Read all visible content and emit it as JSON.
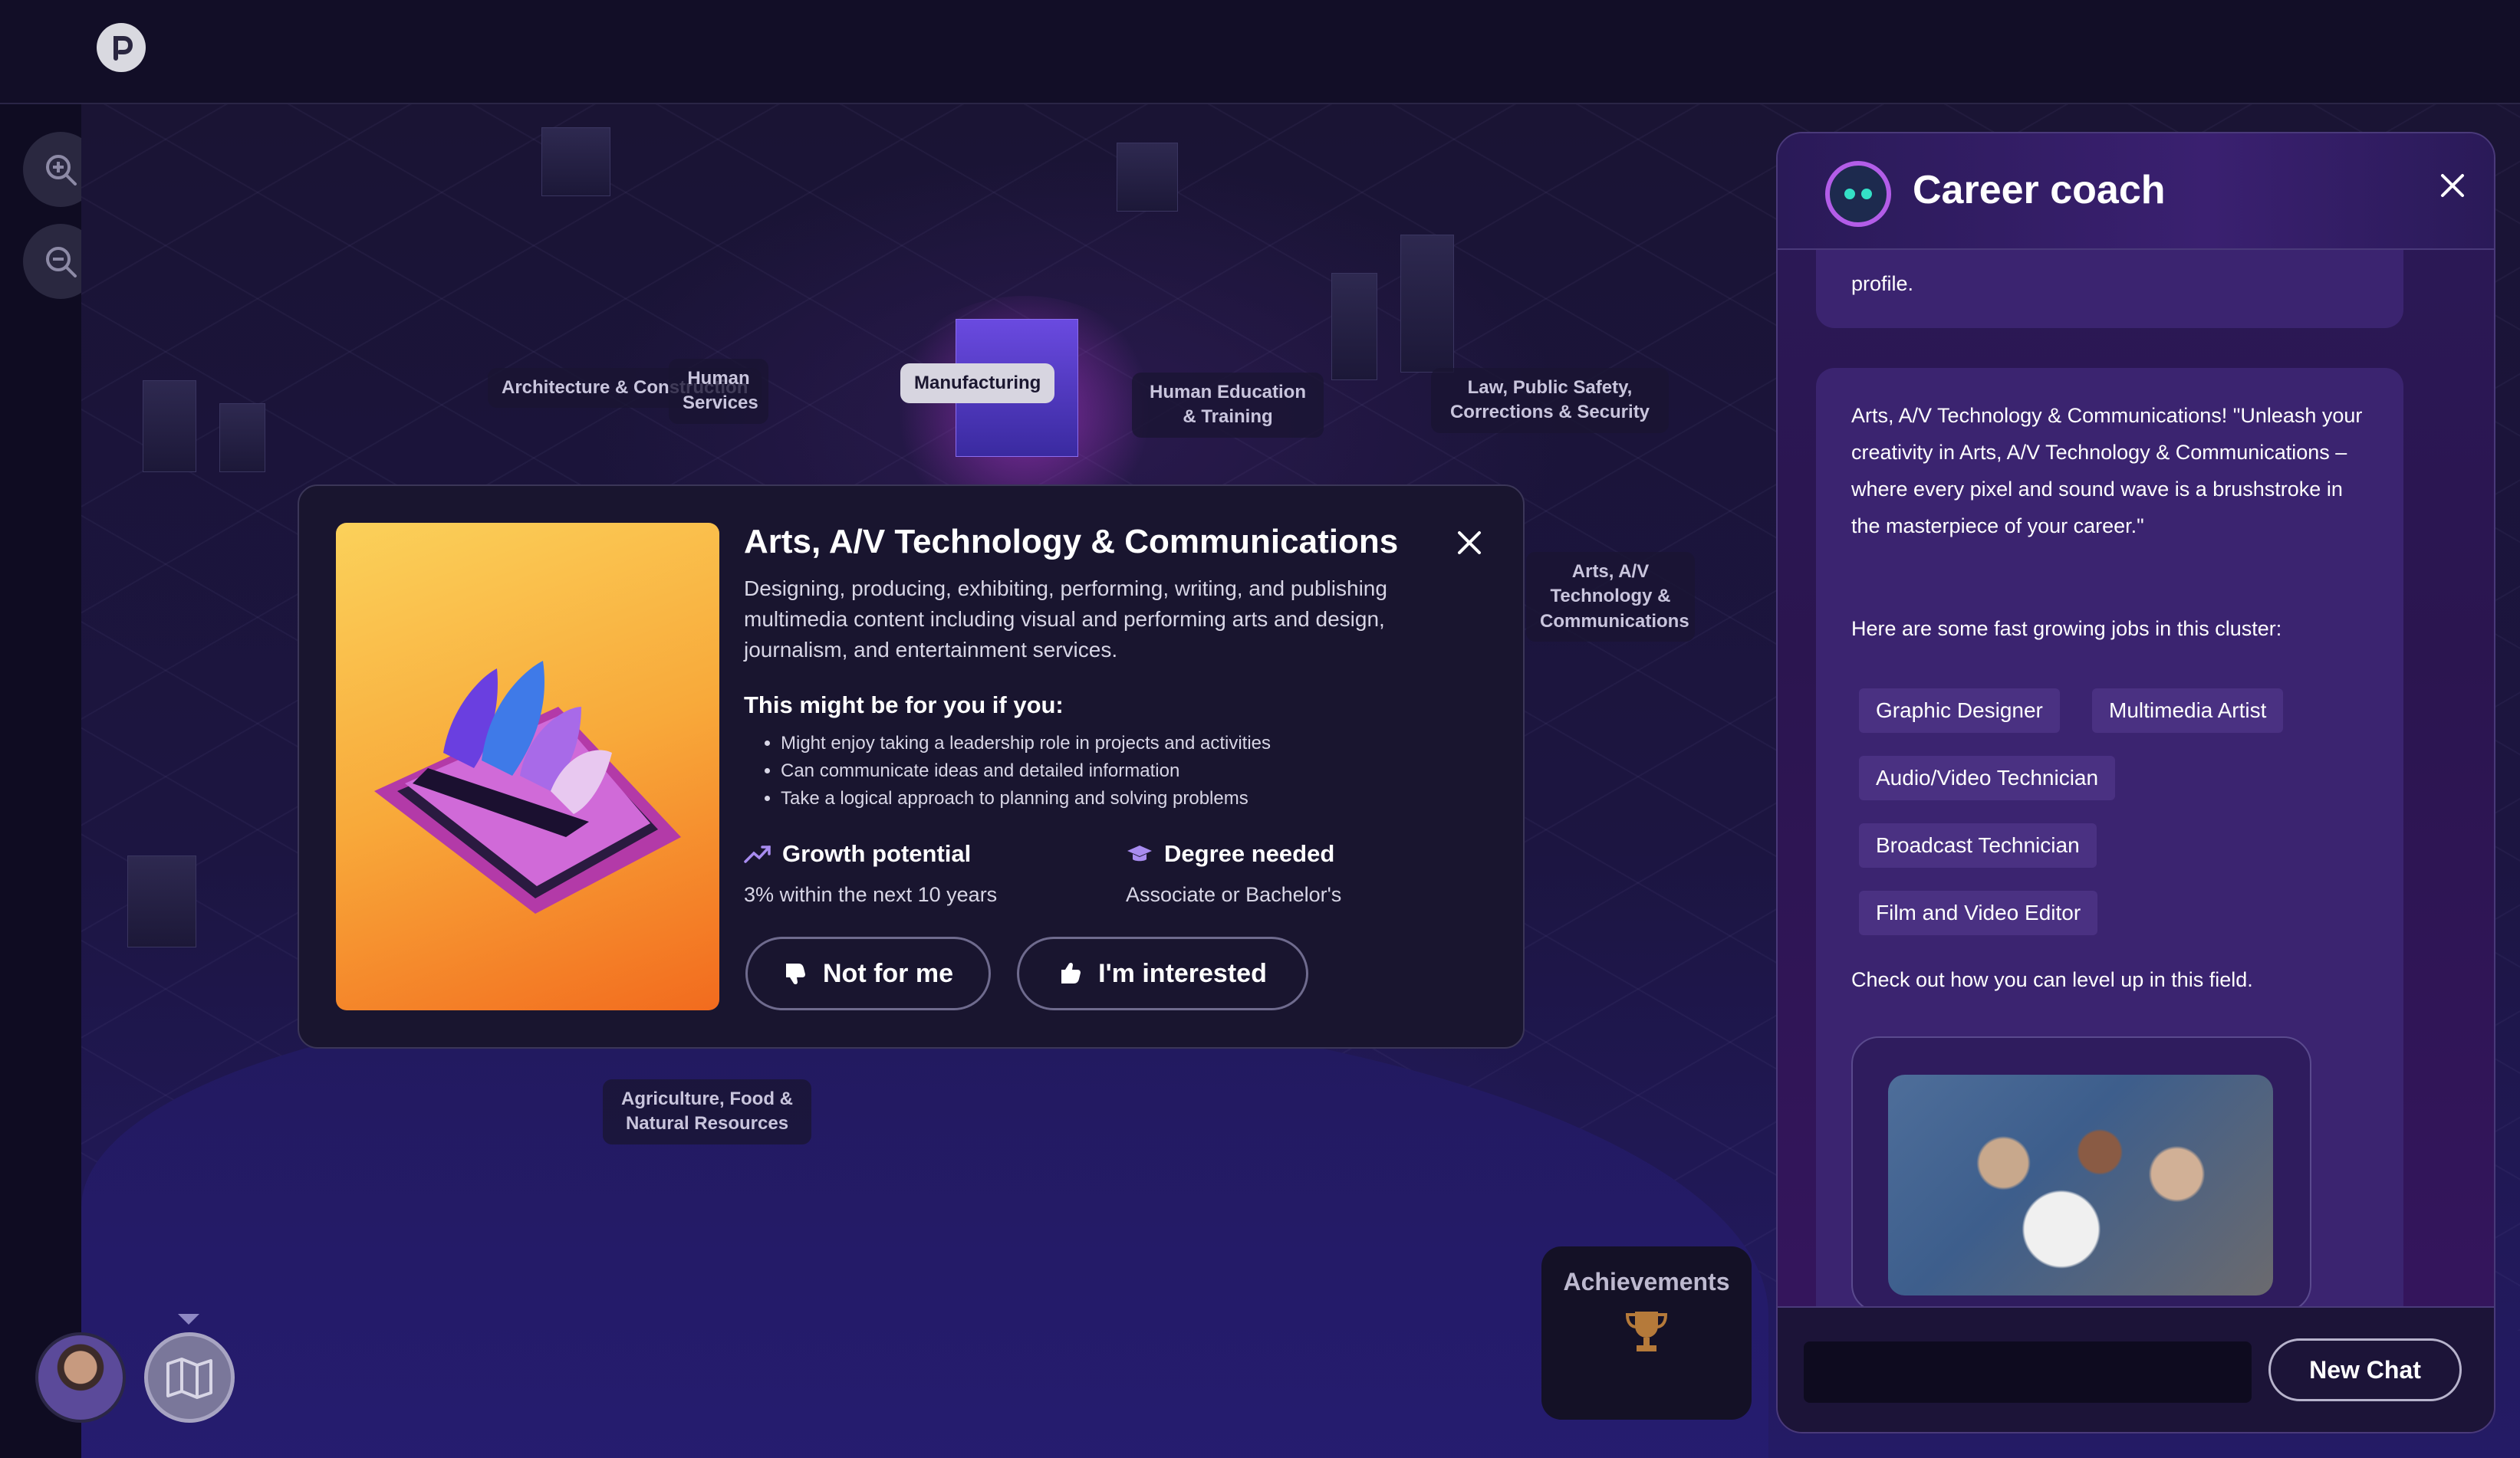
{
  "app": {
    "logo_icon": "pearson-p-icon"
  },
  "map": {
    "zoom_in_icon": "zoom-in-icon",
    "zoom_out_icon": "zoom-out-icon",
    "clusters": [
      {
        "label": "Architecture & Construction"
      },
      {
        "label": "Human Services"
      },
      {
        "label": "Manufacturing"
      },
      {
        "label": "Human Education & Training"
      },
      {
        "label": "Law, Public Safety, Corrections & Security"
      },
      {
        "label": "Arts, A/V Technology & Communications"
      },
      {
        "label": "Agriculture, Food & Natural Resources"
      }
    ]
  },
  "modal": {
    "title": "Arts, A/V Technology & Communications",
    "description": "Designing, producing, exhibiting, performing, writing, and publishing multimedia content including visual and performing arts and design, journalism, and entertainment services.",
    "subheading": "This might be for you if you:",
    "bullets": [
      "Might enjoy taking a leadership role in projects and activities",
      "Can communicate ideas and detailed information",
      "Take a logical approach to planning and solving problems"
    ],
    "growth_label": "Growth potential",
    "growth_value": "3% within the next 10 years",
    "degree_label": "Degree needed",
    "degree_value": "Associate or Bachelor's",
    "not_for_me_label": "Not for me",
    "interested_label": "I'm interested"
  },
  "achievements": {
    "title": "Achievements"
  },
  "coach": {
    "title": "Career coach",
    "prev_message_tail": "profile.",
    "message_intro": "Arts, A/V Technology & Communications! \"Unleash your creativity in Arts, A/V Technology & Communications – where every pixel and sound wave is a brushstroke in the masterpiece of your career.\"",
    "jobs_intro": "Here are some fast growing jobs in this cluster:",
    "jobs": [
      "Graphic Designer",
      "Multimedia Artist",
      "Audio/Video Technician",
      "Broadcast Technician",
      "Film and Video Editor"
    ],
    "level_up": "Check out how you can level up in this field.",
    "input_placeholder": "",
    "new_chat_label": "New Chat"
  },
  "colors": {
    "accent_purple": "#b35de8",
    "panel_bg": "#2b1957",
    "modal_bg": "#19152f",
    "card_orange": "#f8a93a"
  }
}
